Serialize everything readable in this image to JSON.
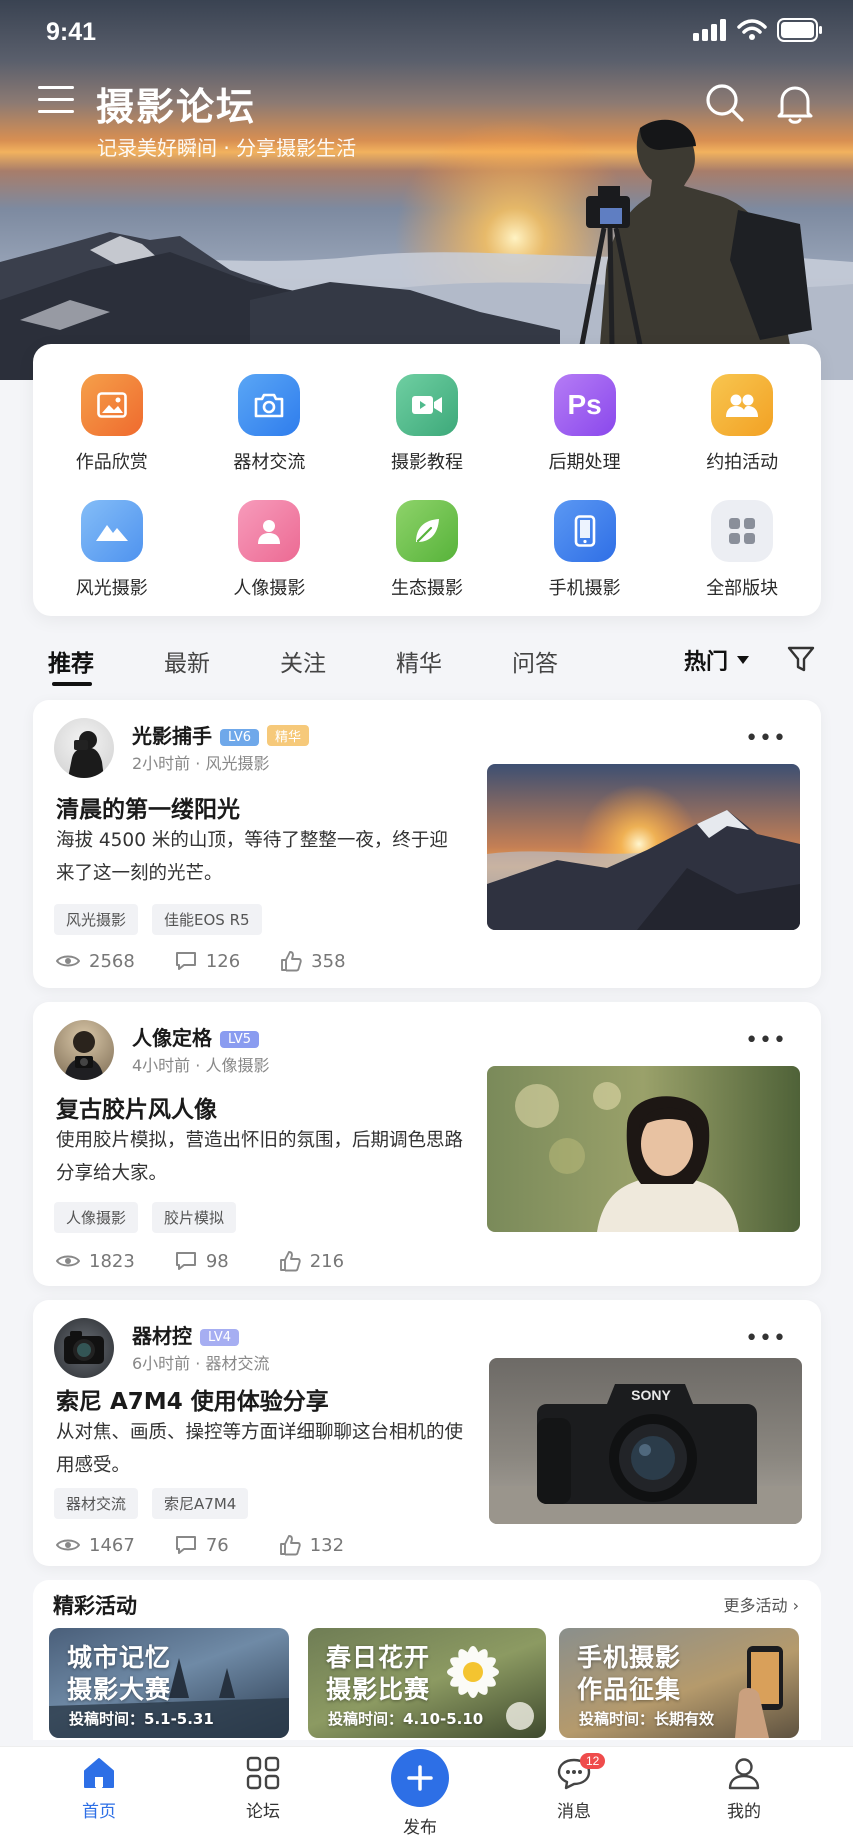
{
  "status_bar": {
    "time": "9:41"
  },
  "header": {
    "title": "摄影论坛",
    "subtitle": "记录美好瞬间 · 分享摄影生活"
  },
  "categories": [
    {
      "label": "作品欣赏",
      "icon": "image-icon",
      "color": "#f07a3a"
    },
    {
      "label": "器材交流",
      "icon": "camera-icon",
      "color": "#3d8ff0"
    },
    {
      "label": "摄影教程",
      "icon": "video-icon",
      "color": "#4fba8c"
    },
    {
      "label": "后期处理",
      "icon": "ps-icon",
      "color": "#9b5cf0"
    },
    {
      "label": "约拍活动",
      "icon": "people-icon",
      "color": "#f5b02f"
    },
    {
      "label": "风光摄影",
      "icon": "mountain-icon",
      "color": "#5aa0f2"
    },
    {
      "label": "人像摄影",
      "icon": "person-icon",
      "color": "#f07aa0"
    },
    {
      "label": "生态摄影",
      "icon": "leaf-icon",
      "color": "#6cc24a"
    },
    {
      "label": "手机摄影",
      "icon": "phone-icon",
      "color": "#3d80ec"
    },
    {
      "label": "全部版块",
      "icon": "grid-icon",
      "color": "#eceef3"
    }
  ],
  "tabs": [
    "推荐",
    "最新",
    "关注",
    "精华",
    "问答"
  ],
  "sort_label": "热门",
  "posts": [
    {
      "author": "光影捕手",
      "level": "LV6",
      "featured": "精华",
      "meta": "2小时前 · 风光摄影",
      "title": "清晨的第一缕阳光",
      "desc": "海拔 4500 米的山顶，等待了整整一夜，终于迎来了这一刻的光芒。",
      "tags": [
        "风光摄影",
        "佳能EOS R5"
      ],
      "views": "2568",
      "comments": "126",
      "likes": "358"
    },
    {
      "author": "人像定格",
      "level": "LV5",
      "meta": "4小时前 · 人像摄影",
      "title": "复古胶片风人像",
      "desc": "使用胶片模拟，营造出怀旧的氛围，后期调色思路分享给大家。",
      "tags": [
        "人像摄影",
        "胶片模拟"
      ],
      "views": "1823",
      "comments": "98",
      "likes": "216"
    },
    {
      "author": "器材控",
      "level": "LV4",
      "meta": "6小时前 · 器材交流",
      "title": "索尼 A7M4 使用体验分享",
      "desc": "从对焦、画质、操控等方面详细聊聊这台相机的使用感受。",
      "tags": [
        "器材交流",
        "索尼A7M4"
      ],
      "views": "1467",
      "comments": "76",
      "likes": "132",
      "camera_brand": "SONY"
    }
  ],
  "activities": {
    "title": "精彩活动",
    "more": "更多活动",
    "items": [
      {
        "line1": "城市记忆",
        "line2": "摄影大赛",
        "date": "投稿时间：5.1-5.31"
      },
      {
        "line1": "春日花开",
        "line2": "摄影比赛",
        "date": "投稿时间：4.10-5.10"
      },
      {
        "line1": "手机摄影",
        "line2": "作品征集",
        "date": "投稿时间：长期有效"
      }
    ]
  },
  "bottom_nav": [
    {
      "label": "首页",
      "icon": "home-icon"
    },
    {
      "label": "论坛",
      "icon": "forum-grid-icon"
    },
    {
      "label": "发布",
      "icon": "plus-icon"
    },
    {
      "label": "消息",
      "icon": "message-icon",
      "badge": "12"
    },
    {
      "label": "我的",
      "icon": "user-icon"
    }
  ],
  "colors": {
    "accent": "#2d6fe6",
    "badge_red": "#ef4c4c"
  }
}
